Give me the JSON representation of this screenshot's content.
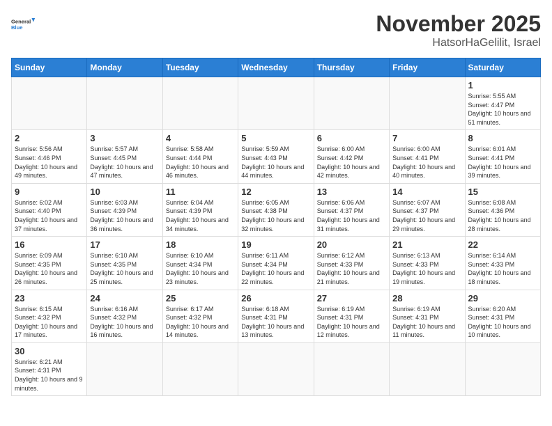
{
  "header": {
    "logo_general": "General",
    "logo_blue": "Blue",
    "month": "November 2025",
    "location": "HatsorHaGelilit, Israel"
  },
  "weekdays": [
    "Sunday",
    "Monday",
    "Tuesday",
    "Wednesday",
    "Thursday",
    "Friday",
    "Saturday"
  ],
  "weeks": [
    [
      {
        "day": "",
        "info": ""
      },
      {
        "day": "",
        "info": ""
      },
      {
        "day": "",
        "info": ""
      },
      {
        "day": "",
        "info": ""
      },
      {
        "day": "",
        "info": ""
      },
      {
        "day": "",
        "info": ""
      },
      {
        "day": "1",
        "info": "Sunrise: 5:55 AM\nSunset: 4:47 PM\nDaylight: 10 hours and 51 minutes."
      }
    ],
    [
      {
        "day": "2",
        "info": "Sunrise: 5:56 AM\nSunset: 4:46 PM\nDaylight: 10 hours and 49 minutes."
      },
      {
        "day": "3",
        "info": "Sunrise: 5:57 AM\nSunset: 4:45 PM\nDaylight: 10 hours and 47 minutes."
      },
      {
        "day": "4",
        "info": "Sunrise: 5:58 AM\nSunset: 4:44 PM\nDaylight: 10 hours and 46 minutes."
      },
      {
        "day": "5",
        "info": "Sunrise: 5:59 AM\nSunset: 4:43 PM\nDaylight: 10 hours and 44 minutes."
      },
      {
        "day": "6",
        "info": "Sunrise: 6:00 AM\nSunset: 4:42 PM\nDaylight: 10 hours and 42 minutes."
      },
      {
        "day": "7",
        "info": "Sunrise: 6:00 AM\nSunset: 4:41 PM\nDaylight: 10 hours and 40 minutes."
      },
      {
        "day": "8",
        "info": "Sunrise: 6:01 AM\nSunset: 4:41 PM\nDaylight: 10 hours and 39 minutes."
      }
    ],
    [
      {
        "day": "9",
        "info": "Sunrise: 6:02 AM\nSunset: 4:40 PM\nDaylight: 10 hours and 37 minutes."
      },
      {
        "day": "10",
        "info": "Sunrise: 6:03 AM\nSunset: 4:39 PM\nDaylight: 10 hours and 36 minutes."
      },
      {
        "day": "11",
        "info": "Sunrise: 6:04 AM\nSunset: 4:39 PM\nDaylight: 10 hours and 34 minutes."
      },
      {
        "day": "12",
        "info": "Sunrise: 6:05 AM\nSunset: 4:38 PM\nDaylight: 10 hours and 32 minutes."
      },
      {
        "day": "13",
        "info": "Sunrise: 6:06 AM\nSunset: 4:37 PM\nDaylight: 10 hours and 31 minutes."
      },
      {
        "day": "14",
        "info": "Sunrise: 6:07 AM\nSunset: 4:37 PM\nDaylight: 10 hours and 29 minutes."
      },
      {
        "day": "15",
        "info": "Sunrise: 6:08 AM\nSunset: 4:36 PM\nDaylight: 10 hours and 28 minutes."
      }
    ],
    [
      {
        "day": "16",
        "info": "Sunrise: 6:09 AM\nSunset: 4:35 PM\nDaylight: 10 hours and 26 minutes."
      },
      {
        "day": "17",
        "info": "Sunrise: 6:10 AM\nSunset: 4:35 PM\nDaylight: 10 hours and 25 minutes."
      },
      {
        "day": "18",
        "info": "Sunrise: 6:10 AM\nSunset: 4:34 PM\nDaylight: 10 hours and 23 minutes."
      },
      {
        "day": "19",
        "info": "Sunrise: 6:11 AM\nSunset: 4:34 PM\nDaylight: 10 hours and 22 minutes."
      },
      {
        "day": "20",
        "info": "Sunrise: 6:12 AM\nSunset: 4:33 PM\nDaylight: 10 hours and 21 minutes."
      },
      {
        "day": "21",
        "info": "Sunrise: 6:13 AM\nSunset: 4:33 PM\nDaylight: 10 hours and 19 minutes."
      },
      {
        "day": "22",
        "info": "Sunrise: 6:14 AM\nSunset: 4:33 PM\nDaylight: 10 hours and 18 minutes."
      }
    ],
    [
      {
        "day": "23",
        "info": "Sunrise: 6:15 AM\nSunset: 4:32 PM\nDaylight: 10 hours and 17 minutes."
      },
      {
        "day": "24",
        "info": "Sunrise: 6:16 AM\nSunset: 4:32 PM\nDaylight: 10 hours and 16 minutes."
      },
      {
        "day": "25",
        "info": "Sunrise: 6:17 AM\nSunset: 4:32 PM\nDaylight: 10 hours and 14 minutes."
      },
      {
        "day": "26",
        "info": "Sunrise: 6:18 AM\nSunset: 4:31 PM\nDaylight: 10 hours and 13 minutes."
      },
      {
        "day": "27",
        "info": "Sunrise: 6:19 AM\nSunset: 4:31 PM\nDaylight: 10 hours and 12 minutes."
      },
      {
        "day": "28",
        "info": "Sunrise: 6:19 AM\nSunset: 4:31 PM\nDaylight: 10 hours and 11 minutes."
      },
      {
        "day": "29",
        "info": "Sunrise: 6:20 AM\nSunset: 4:31 PM\nDaylight: 10 hours and 10 minutes."
      }
    ],
    [
      {
        "day": "30",
        "info": "Sunrise: 6:21 AM\nSunset: 4:31 PM\nDaylight: 10 hours and 9 minutes."
      },
      {
        "day": "",
        "info": ""
      },
      {
        "day": "",
        "info": ""
      },
      {
        "day": "",
        "info": ""
      },
      {
        "day": "",
        "info": ""
      },
      {
        "day": "",
        "info": ""
      },
      {
        "day": "",
        "info": ""
      }
    ]
  ]
}
